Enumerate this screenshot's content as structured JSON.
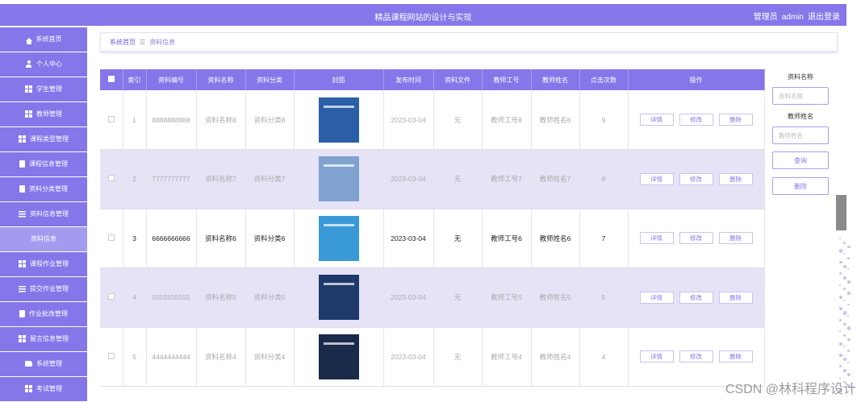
{
  "header": {
    "title": "精品课程网站的设计与实现",
    "user_role": "管理员",
    "user_name": "admin",
    "logout": "退出登录"
  },
  "sidebar": {
    "items": [
      {
        "label": "系统首页",
        "icon": "home-icon"
      },
      {
        "label": "个人中心",
        "icon": "person-icon"
      },
      {
        "label": "学生管理",
        "icon": "grid-icon"
      },
      {
        "label": "教师管理",
        "icon": "grid-icon"
      },
      {
        "label": "课程类型管理",
        "icon": "grid-icon"
      },
      {
        "label": "课程信息管理",
        "icon": "document-icon"
      },
      {
        "label": "资料分类管理",
        "icon": "document-icon"
      },
      {
        "label": "资料信息管理",
        "icon": "list-icon"
      },
      {
        "label": "资料信息",
        "icon": ""
      },
      {
        "label": "课程作业管理",
        "icon": "grid-icon"
      },
      {
        "label": "提交作业管理",
        "icon": "list-icon"
      },
      {
        "label": "作业批改管理",
        "icon": "document-icon"
      },
      {
        "label": "留言信息管理",
        "icon": "grid-icon"
      },
      {
        "label": "系统管理",
        "icon": "thumb-icon"
      },
      {
        "label": "考试管理",
        "icon": "grid-icon"
      }
    ],
    "active_index": 8
  },
  "breadcrumb": {
    "home": "系统首页",
    "separator": "☰",
    "current": "资料信息"
  },
  "table": {
    "columns": [
      "索引",
      "资料编号",
      "资料名称",
      "资料分类",
      "封面",
      "发布时间",
      "资料文件",
      "教师工号",
      "教师姓名",
      "点击次数",
      "操作"
    ],
    "rows": [
      {
        "index": "1",
        "code": "8888888888",
        "name": "资料名称8",
        "category": "资料分类8",
        "cover_color": "#2a5fa8",
        "date": "2023-03-04",
        "file": "无",
        "teacher_no": "教师工号8",
        "teacher_name": "教师姓名8",
        "clicks": "9"
      },
      {
        "index": "2",
        "code": "7777777777",
        "name": "资料名称7",
        "category": "资料分类7",
        "cover_color": "#7fa2d0",
        "date": "2023-03-04",
        "file": "无",
        "teacher_no": "教师工号7",
        "teacher_name": "教师姓名7",
        "clicks": "8"
      },
      {
        "index": "3",
        "code": "6666666666",
        "name": "资料名称6",
        "category": "资料分类6",
        "cover_color": "#3a9ad8",
        "date": "2023-03-04",
        "file": "无",
        "teacher_no": "教师工号6",
        "teacher_name": "教师姓名6",
        "clicks": "7"
      },
      {
        "index": "4",
        "code": "5555555555",
        "name": "资料名称5",
        "category": "资料分类5",
        "cover_color": "#1e3a6a",
        "date": "2023-03-04",
        "file": "无",
        "teacher_no": "教师工号5",
        "teacher_name": "教师姓名5",
        "clicks": "5"
      },
      {
        "index": "5",
        "code": "4444444444",
        "name": "资料名称4",
        "category": "资料分类4",
        "cover_color": "#1a2a4a",
        "date": "2023-03-04",
        "file": "无",
        "teacher_no": "教师工号4",
        "teacher_name": "教师姓名4",
        "clicks": "4"
      }
    ],
    "actions": {
      "detail": "详情",
      "edit": "修改",
      "delete": "删除"
    }
  },
  "search": {
    "name_label": "资料名称",
    "name_placeholder": "资料名称",
    "teacher_label": "教师姓名",
    "teacher_placeholder": "教师姓名",
    "query_button": "查询",
    "delete_button": "删除"
  },
  "watermark": "CSDN @林科程序设计",
  "colors": {
    "accent": "#8577ea"
  }
}
